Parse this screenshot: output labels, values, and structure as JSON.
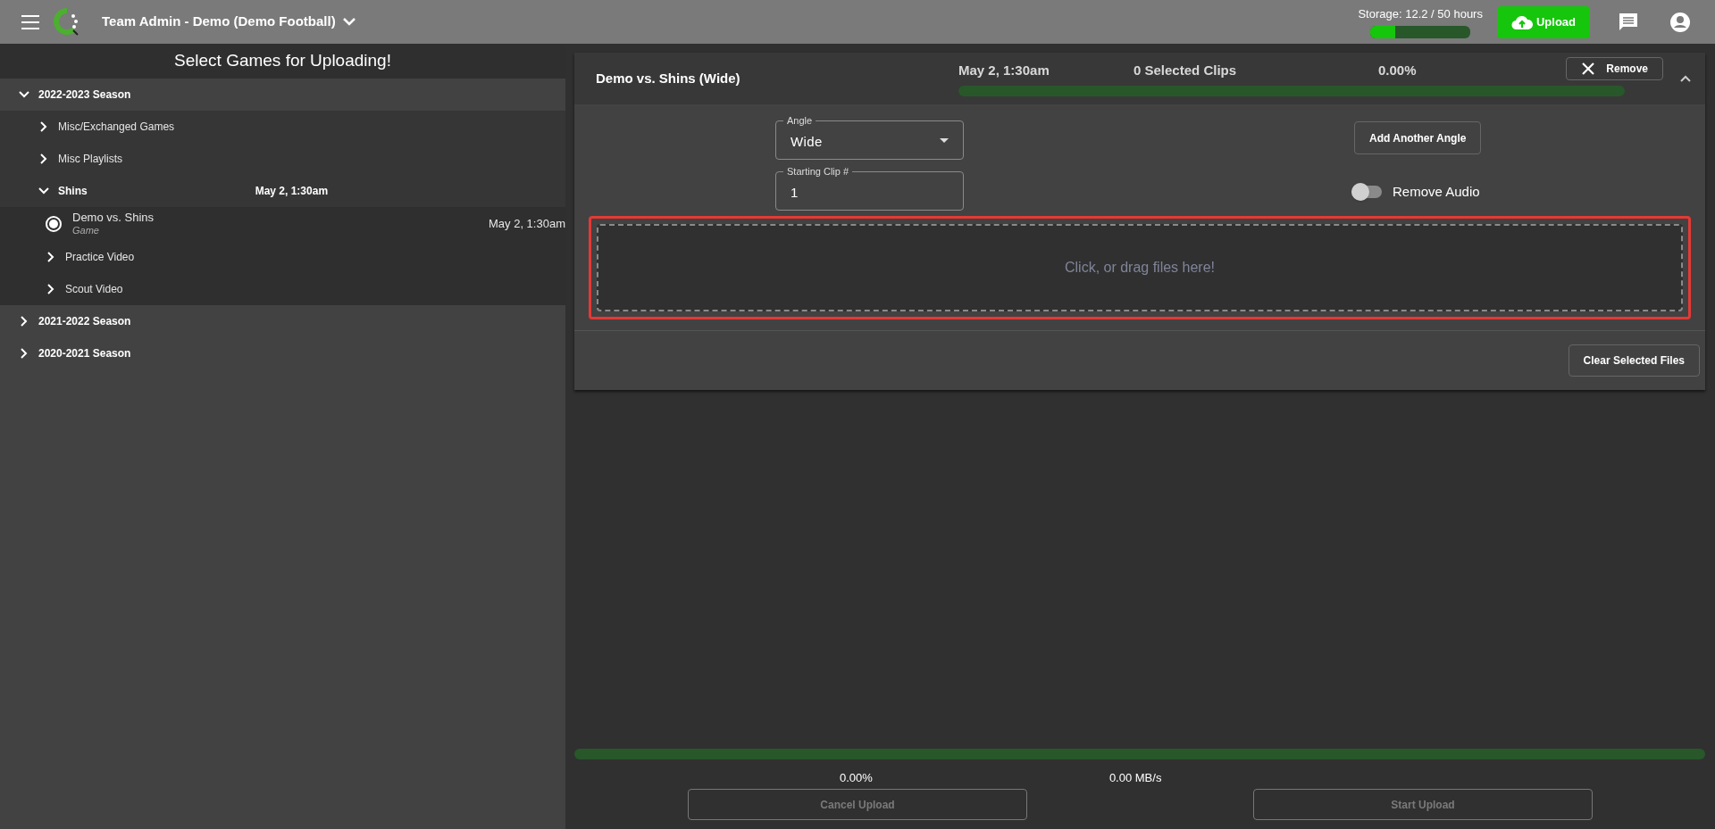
{
  "topbar": {
    "title": "Team Admin - Demo (Demo Football)",
    "storage": {
      "label": "Storage: 12.2 / 50 hours",
      "level": 0.244
    },
    "upload_button": "Upload"
  },
  "sidebar": {
    "heading": "Select Games for Uploading!",
    "tree": [
      {
        "kind": "folder",
        "label": "2022-2023 Season",
        "expanded": true,
        "children": [
          {
            "kind": "folder",
            "label": "Misc/Exchanged Games",
            "expanded": false
          },
          {
            "kind": "folder",
            "label": "Misc Playlists",
            "expanded": false
          },
          {
            "kind": "folder",
            "label": "Shins",
            "date": "May 2, 1:30am",
            "expanded": true,
            "children": [
              {
                "kind": "game",
                "label": "Demo vs. Shins",
                "subtitle": "Game",
                "date": "May 2, 1:30am",
                "selected": true
              },
              {
                "kind": "folder",
                "label": "Practice Video",
                "expanded": false
              },
              {
                "kind": "folder",
                "label": "Scout Video",
                "expanded": false
              }
            ]
          }
        ]
      },
      {
        "kind": "folder",
        "label": "2021-2022 Season",
        "expanded": false
      },
      {
        "kind": "folder",
        "label": "2020-2021 Season",
        "expanded": false
      }
    ]
  },
  "upload_card": {
    "title": "Demo vs. Shins (Wide)",
    "date": "May 2, 1:30am",
    "clips": "0 Selected Clips",
    "percent": "0.00%",
    "level": 0,
    "remove_button": "Remove",
    "expanded": true,
    "angle": {
      "label": "Angle",
      "value": "Wide"
    },
    "starting_clip": {
      "label": "Starting Clip #",
      "value": "1"
    },
    "add_angle_button": "Add Another Angle",
    "remove_audio": {
      "label": "Remove Audio",
      "on": false
    },
    "dropzone": "Click, or drag files here!",
    "clear_button": "Clear Selected Files"
  },
  "footer": {
    "level": 0,
    "percent": "0.00%",
    "speed": "0.00 MB/s",
    "cancel_button": {
      "label": "Cancel Upload",
      "disabled": true
    },
    "start_button": {
      "label": "Start Upload",
      "disabled": true
    }
  }
}
